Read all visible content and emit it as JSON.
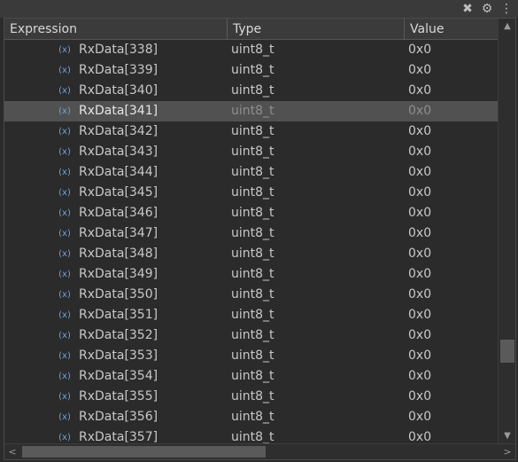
{
  "toolbar": {
    "icons": [
      "remove-all-icon",
      "collapse-all-icon",
      "view-menu-icon"
    ],
    "remove_glyph": "✖",
    "collapse_glyph": "⚙",
    "menu_glyph": "⋮"
  },
  "table": {
    "columns": [
      "Expression",
      "Type",
      "Value"
    ],
    "selected_index": 3,
    "rows": [
      {
        "expression": "RxData[338]",
        "type": "uint8_t",
        "value": "0x0"
      },
      {
        "expression": "RxData[339]",
        "type": "uint8_t",
        "value": "0x0"
      },
      {
        "expression": "RxData[340]",
        "type": "uint8_t",
        "value": "0x0"
      },
      {
        "expression": "RxData[341]",
        "type": "uint8_t",
        "value": "0x0"
      },
      {
        "expression": "RxData[342]",
        "type": "uint8_t",
        "value": "0x0"
      },
      {
        "expression": "RxData[343]",
        "type": "uint8_t",
        "value": "0x0"
      },
      {
        "expression": "RxData[344]",
        "type": "uint8_t",
        "value": "0x0"
      },
      {
        "expression": "RxData[345]",
        "type": "uint8_t",
        "value": "0x0"
      },
      {
        "expression": "RxData[346]",
        "type": "uint8_t",
        "value": "0x0"
      },
      {
        "expression": "RxData[347]",
        "type": "uint8_t",
        "value": "0x0"
      },
      {
        "expression": "RxData[348]",
        "type": "uint8_t",
        "value": "0x0"
      },
      {
        "expression": "RxData[349]",
        "type": "uint8_t",
        "value": "0x0"
      },
      {
        "expression": "RxData[350]",
        "type": "uint8_t",
        "value": "0x0"
      },
      {
        "expression": "RxData[351]",
        "type": "uint8_t",
        "value": "0x0"
      },
      {
        "expression": "RxData[352]",
        "type": "uint8_t",
        "value": "0x0"
      },
      {
        "expression": "RxData[353]",
        "type": "uint8_t",
        "value": "0x0"
      },
      {
        "expression": "RxData[354]",
        "type": "uint8_t",
        "value": "0x0"
      },
      {
        "expression": "RxData[355]",
        "type": "uint8_t",
        "value": "0x0"
      },
      {
        "expression": "RxData[356]",
        "type": "uint8_t",
        "value": "0x0"
      },
      {
        "expression": "RxData[357]",
        "type": "uint8_t",
        "value": "0x0"
      }
    ]
  },
  "variable_icon": "(x)",
  "scrollbars": {
    "up_arrow": "▲",
    "down_arrow": "▼",
    "left_arrow": "<",
    "right_arrow": ">"
  }
}
